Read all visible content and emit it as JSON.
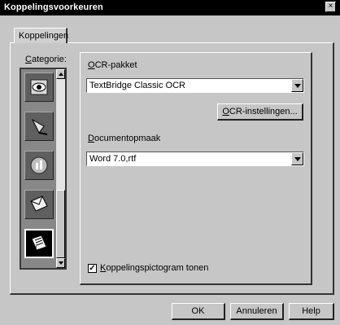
{
  "window": {
    "title": "Koppelingsvoorkeuren",
    "close_glyph": "×"
  },
  "tabs": [
    {
      "label": "Koppelingen"
    }
  ],
  "category": {
    "label": "Categorie:",
    "icons": [
      {
        "name": "eye-scan-icon",
        "selected": false
      },
      {
        "name": "pen-nib-icon",
        "selected": false
      },
      {
        "name": "chart-disc-icon",
        "selected": false
      },
      {
        "name": "mail-envelope-icon",
        "selected": false
      },
      {
        "name": "document-text-icon",
        "selected": true
      }
    ]
  },
  "ocr": {
    "label": "OCR-pakket",
    "value": "TextBridge Classic OCR",
    "settings_button": "OCR-instellingen..."
  },
  "document": {
    "label": "Documentopmaak",
    "value": "Word 7.0,rtf"
  },
  "show_icon": {
    "label": "Koppelingspictogram tonen",
    "checked": true,
    "check_glyph": "✓"
  },
  "buttons": {
    "ok": "OK",
    "cancel": "Annuleren",
    "help": "Help"
  }
}
